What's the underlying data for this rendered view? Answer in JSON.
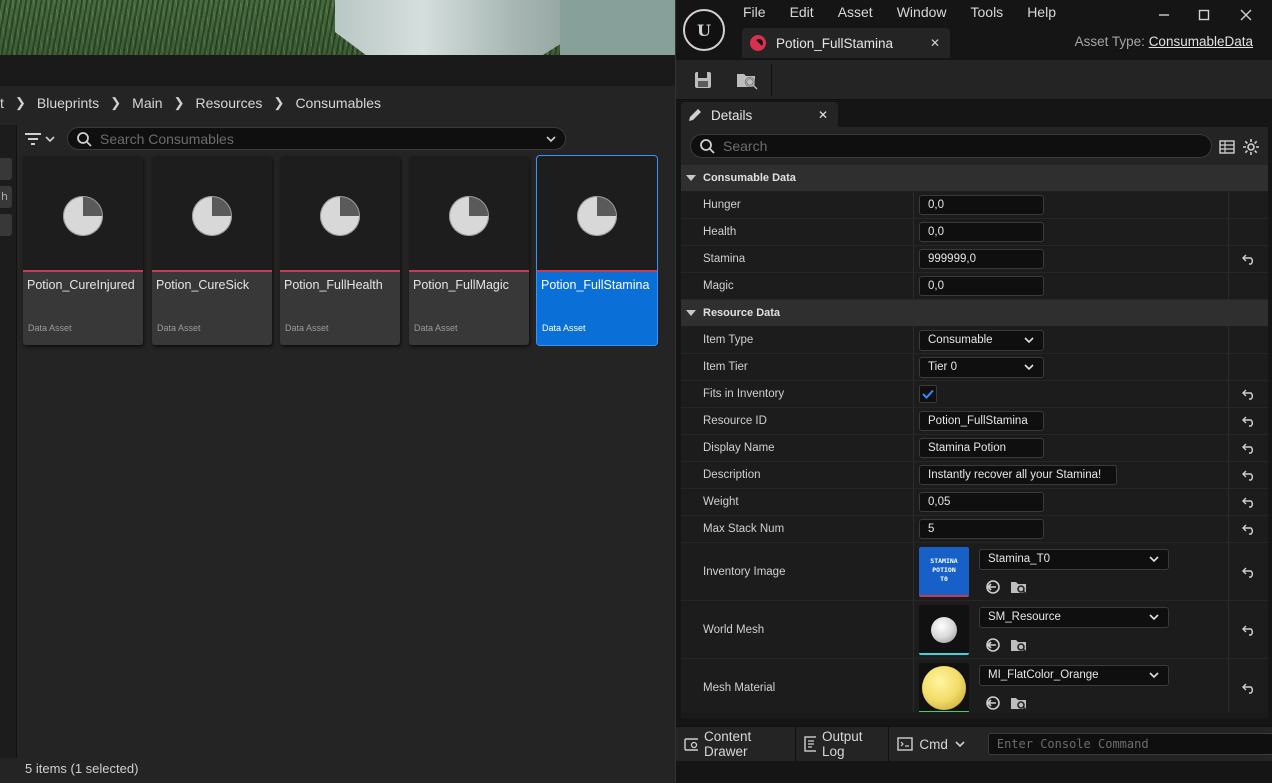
{
  "content_browser": {
    "breadcrumb": [
      "t",
      "Blueprints",
      "Main",
      "Resources",
      "Consumables"
    ],
    "search_placeholder": "Search Consumables",
    "assets": [
      {
        "name": "Potion_CureInjured",
        "type": "Data Asset",
        "selected": false
      },
      {
        "name": "Potion_CureSick",
        "type": "Data Asset",
        "selected": false
      },
      {
        "name": "Potion_FullHealth",
        "type": "Data Asset",
        "selected": false
      },
      {
        "name": "Potion_FullMagic",
        "type": "Data Asset",
        "selected": false
      },
      {
        "name": "Potion_FullStamina",
        "type": "Data Asset",
        "selected": true
      }
    ],
    "status": "5 items (1 selected)",
    "strip_tab_letter": "h"
  },
  "editor": {
    "logo": "U",
    "menu": [
      "File",
      "Edit",
      "Asset",
      "Window",
      "Tools",
      "Help"
    ],
    "tab_title": "Potion_FullStamina",
    "asset_type_label": "Asset Type:",
    "asset_type_value": "ConsumableData",
    "details_tab": "Details",
    "search_placeholder": "Search",
    "categories": {
      "consumable": {
        "title": "Consumable Data",
        "rows": [
          {
            "label": "Hunger",
            "value": "0,0"
          },
          {
            "label": "Health",
            "value": "0,0"
          },
          {
            "label": "Stamina",
            "value": "999999,0"
          },
          {
            "label": "Magic",
            "value": "0,0"
          }
        ]
      },
      "resource": {
        "title": "Resource Data",
        "item_type": {
          "label": "Item Type",
          "value": "Consumable"
        },
        "item_tier": {
          "label": "Item Tier",
          "value": "Tier 0"
        },
        "fits": {
          "label": "Fits in Inventory",
          "checked": true
        },
        "resource_id": {
          "label": "Resource ID",
          "value": "Potion_FullStamina"
        },
        "display_name": {
          "label": "Display Name",
          "value": "Stamina Potion"
        },
        "description": {
          "label": "Description",
          "value": "Instantly recover all your Stamina!"
        },
        "weight": {
          "label": "Weight",
          "value": "0,05"
        },
        "max_stack": {
          "label": "Max Stack Num",
          "value": "5"
        },
        "inventory_image": {
          "label": "Inventory Image",
          "value": "Stamina_T0",
          "thumb_text": [
            "STAMINA",
            "POTION",
            "T0"
          ]
        },
        "world_mesh": {
          "label": "World Mesh",
          "value": "SM_Resource"
        },
        "mesh_material": {
          "label": "Mesh Material",
          "value": "MI_FlatColor_Orange"
        }
      }
    },
    "bottom": {
      "content_drawer": "Content Drawer",
      "output_log": "Output Log",
      "cmd": "Cmd",
      "console_placeholder": "Enter Console Command"
    }
  },
  "colors": {
    "selection_blue": "#0a70d8",
    "asset_underline": "#c43c5a",
    "tab_icon": "#d9304f",
    "check_blue": "#2f8dff"
  }
}
